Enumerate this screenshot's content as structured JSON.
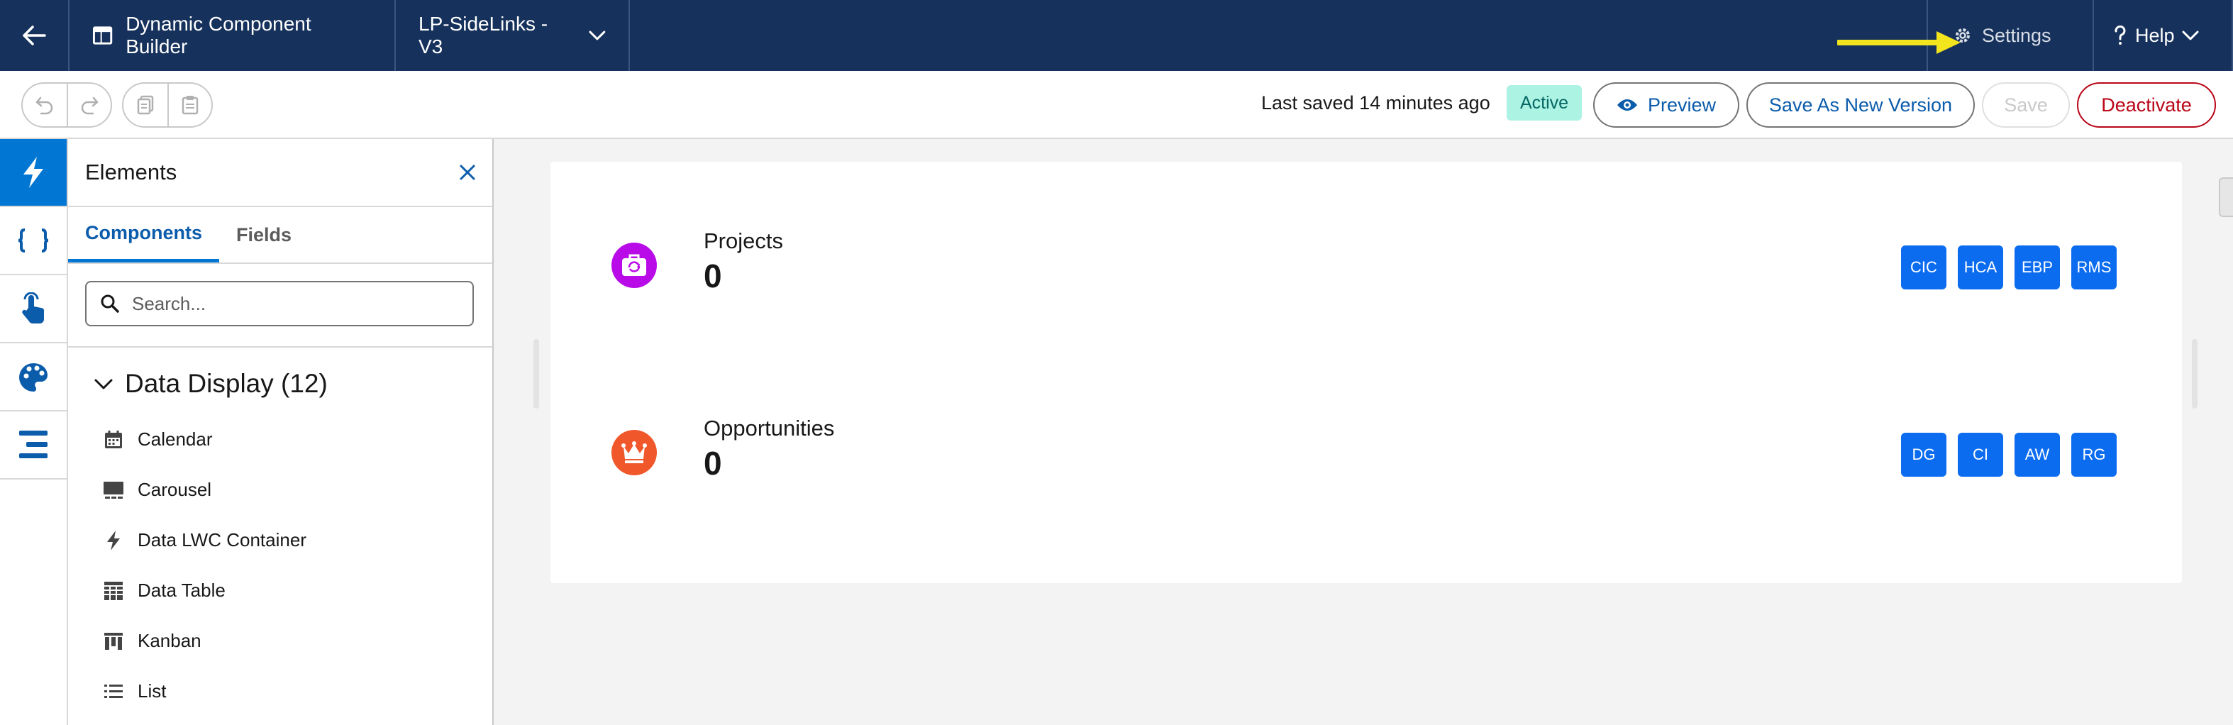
{
  "header": {
    "app_title": "Dynamic Component Builder",
    "version_label": "LP-SideLinks - V3",
    "settings_label": "Settings",
    "help_label": "Help"
  },
  "toolbar": {
    "last_saved": "Last saved 14 minutes ago",
    "status": "Active",
    "preview_label": "Preview",
    "save_new_label": "Save As New Version",
    "save_label": "Save",
    "deactivate_label": "Deactivate"
  },
  "panel": {
    "title": "Elements",
    "tabs": [
      {
        "label": "Components",
        "active": true
      },
      {
        "label": "Fields",
        "active": false
      }
    ],
    "search_placeholder": "Search...",
    "section_title": "Data Display (12)",
    "items": [
      {
        "label": "Calendar",
        "icon": "calendar-icon"
      },
      {
        "label": "Carousel",
        "icon": "carousel-icon"
      },
      {
        "label": "Data LWC Container",
        "icon": "lightning-icon"
      },
      {
        "label": "Data Table",
        "icon": "table-icon"
      },
      {
        "label": "Kanban",
        "icon": "kanban-icon"
      },
      {
        "label": "List",
        "icon": "list-icon"
      }
    ]
  },
  "canvas": {
    "rows": [
      {
        "label": "Projects",
        "value": "0",
        "icon": "projects-icon",
        "icon_color": "#b90be8",
        "chips": [
          "CIC",
          "HCA",
          "EBP",
          "RMS"
        ]
      },
      {
        "label": "Opportunities",
        "value": "0",
        "icon": "crown-icon",
        "icon_color": "#f0572a",
        "chips": [
          "DG",
          "CI",
          "AW",
          "RG"
        ]
      }
    ]
  },
  "colors": {
    "header_bg": "#16325c",
    "brand_blue": "#0176d3",
    "chip_blue": "#0b6cf0",
    "deactivate_red": "#ba0517",
    "active_badge_bg": "#acf3e4",
    "annotation_arrow": "#f2e51d"
  }
}
